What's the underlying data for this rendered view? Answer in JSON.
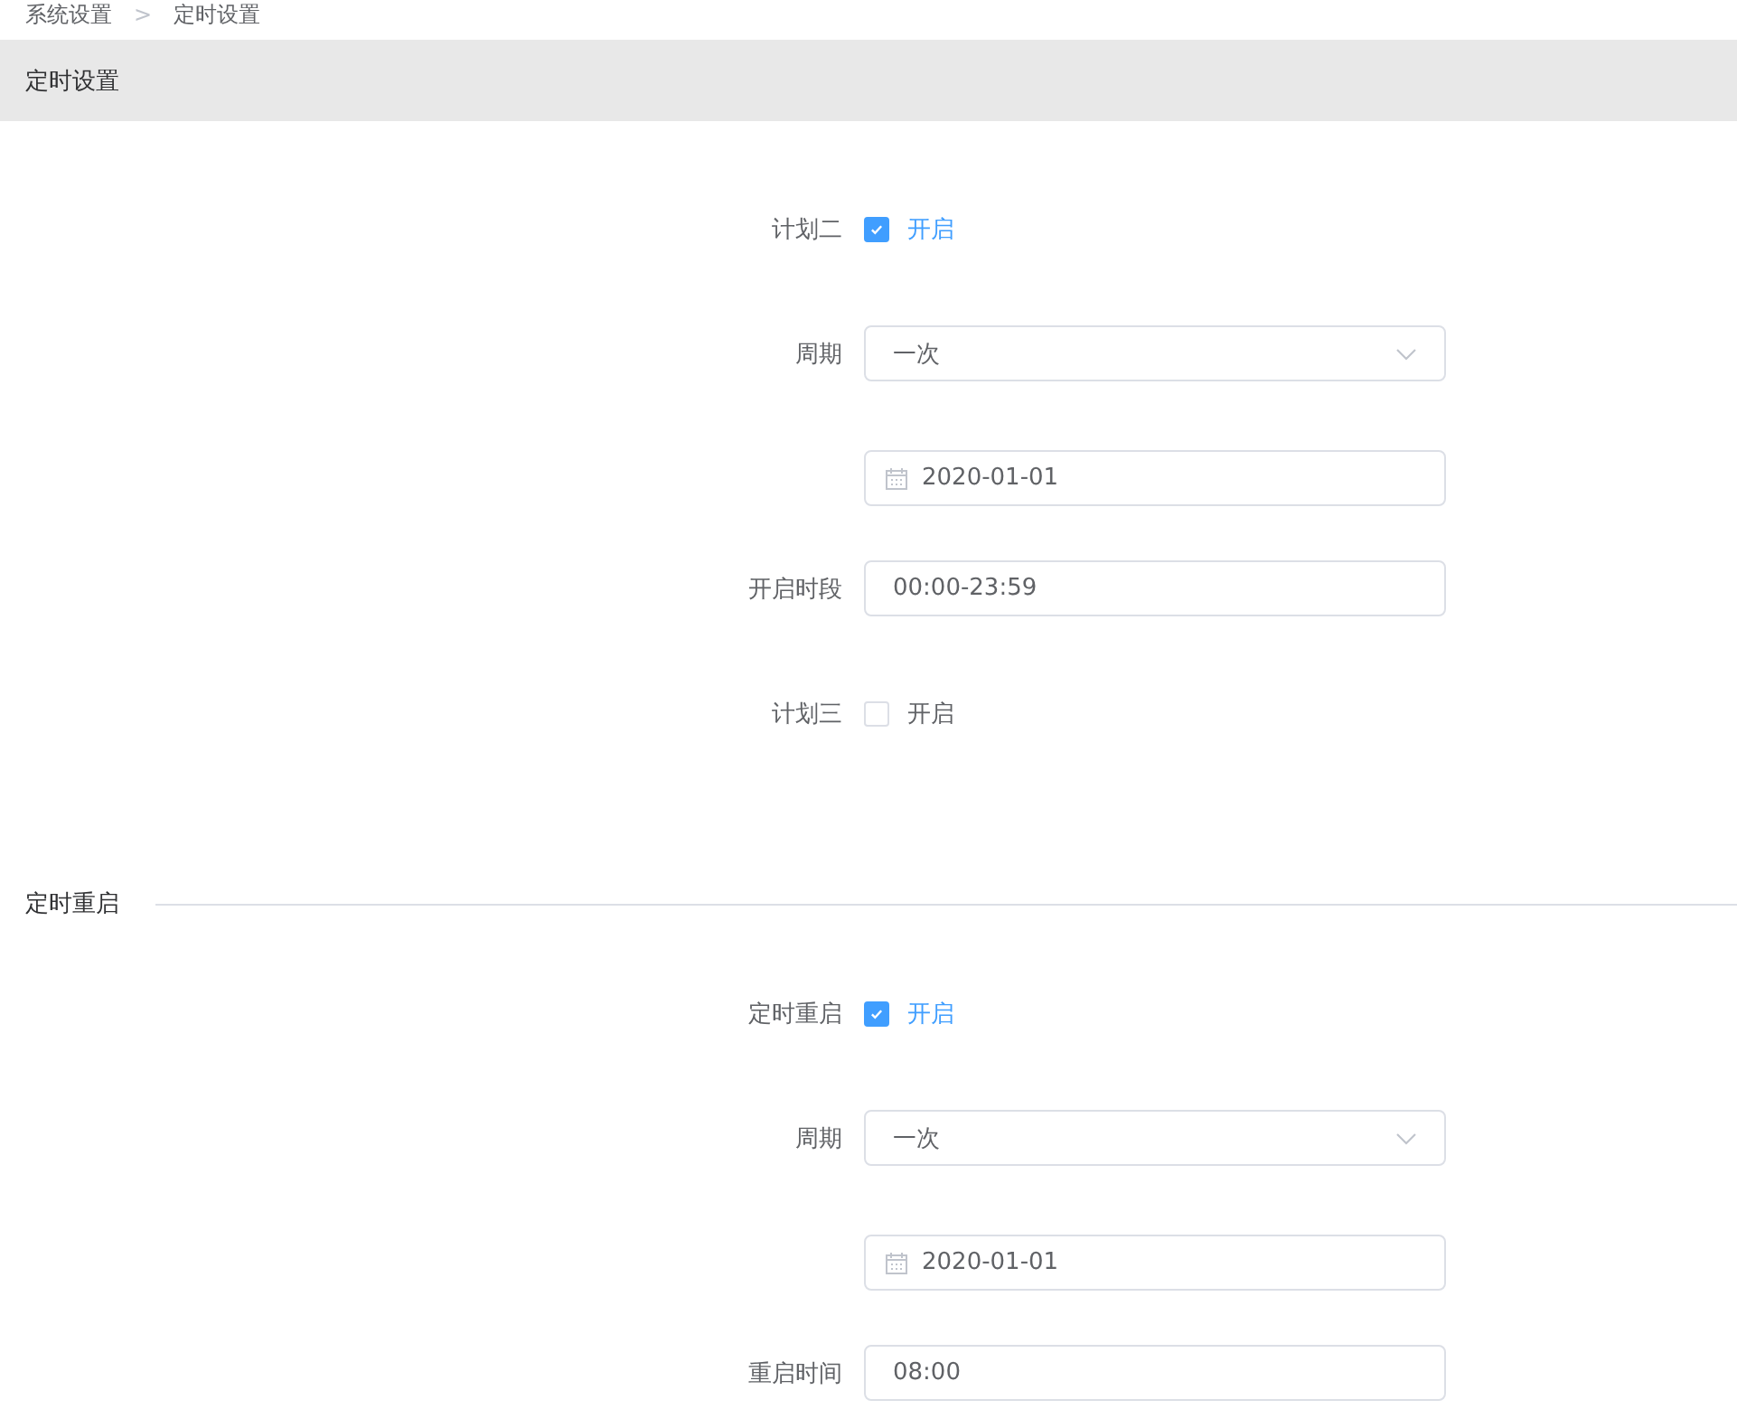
{
  "breadcrumb": {
    "items": [
      "系统设置",
      "定时设置"
    ],
    "separator": ">"
  },
  "header": {
    "title": "定时设置"
  },
  "sections": [
    {
      "rows": [
        {
          "kind": "checkbox",
          "label": "计划二",
          "checked": true,
          "text": "开启"
        },
        {
          "kind": "select",
          "label": "周期",
          "value": "一次"
        },
        {
          "kind": "date",
          "value": "2020-01-01"
        },
        {
          "kind": "input",
          "label": "开启时段",
          "value": "00:00-23:59"
        },
        {
          "kind": "checkbox",
          "label": "计划三",
          "checked": false,
          "text": "开启"
        }
      ]
    },
    {
      "title": "定时重启",
      "rows": [
        {
          "kind": "checkbox",
          "label": "定时重启",
          "checked": true,
          "text": "开启"
        },
        {
          "kind": "select",
          "label": "周期",
          "value": "一次"
        },
        {
          "kind": "date",
          "value": "2020-01-01"
        },
        {
          "kind": "input",
          "label": "重启时间",
          "value": "08:00"
        }
      ]
    }
  ]
}
